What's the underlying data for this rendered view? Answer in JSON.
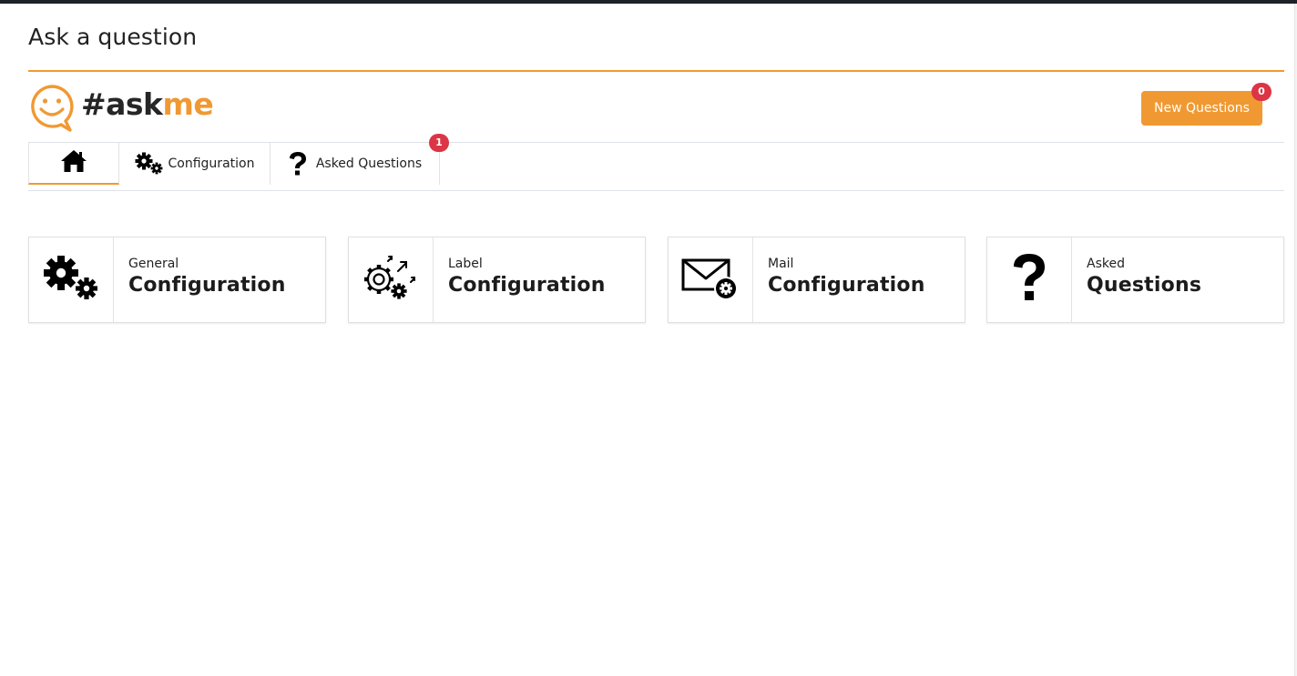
{
  "page": {
    "title": "Ask a question"
  },
  "logo": {
    "hash_text": "#ask",
    "accent_text": "me"
  },
  "header": {
    "new_questions_label": "New Questions",
    "new_questions_count": "0"
  },
  "tabs": [
    {
      "icon": "home-icon",
      "label": ""
    },
    {
      "icon": "gears-icon",
      "label": "Configuration"
    },
    {
      "icon": "question-icon",
      "label": "Asked Questions",
      "badge": "1"
    }
  ],
  "cards": [
    {
      "icon": "gears-icon",
      "subtitle": "General",
      "title": "Configuration"
    },
    {
      "icon": "label-config-icon",
      "subtitle": "Label",
      "title": "Configuration"
    },
    {
      "icon": "mail-config-icon",
      "subtitle": "Mail",
      "title": "Configuration"
    },
    {
      "icon": "question-icon",
      "subtitle": "Asked",
      "title": "Questions"
    }
  ],
  "colors": {
    "accent": "#f09932",
    "badge": "#dc3545",
    "text": "#212529"
  }
}
